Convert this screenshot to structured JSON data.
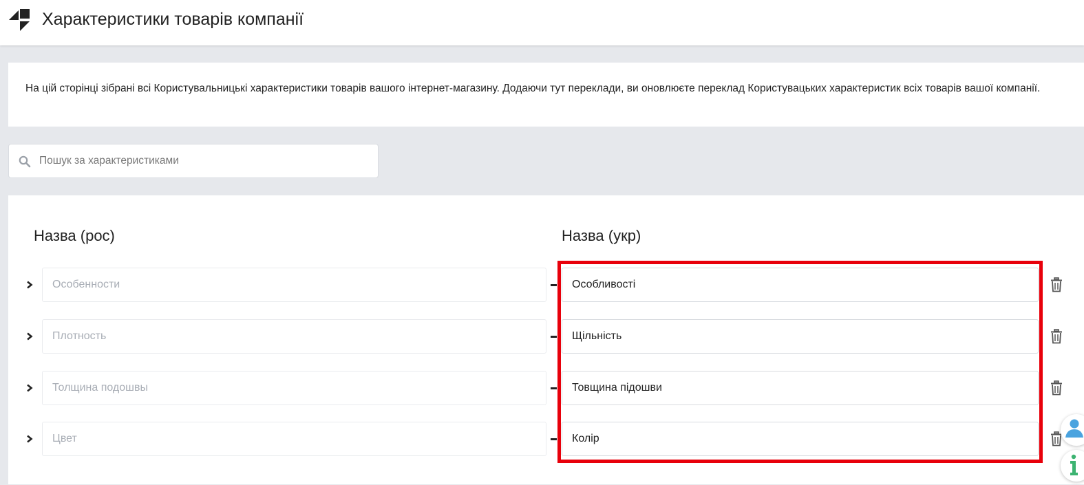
{
  "header": {
    "title": "Характеристики товарів компанії"
  },
  "info": {
    "text": "На цій сторінці зібрані всі Користувальницькі характеристики товарів вашого інтернет-магазину. Додаючи тут переклади, ви оновлюєте переклад Користувацьких характеристик всіх товарів вашої компанії."
  },
  "search": {
    "placeholder": "Пошук за характеристиками",
    "value": ""
  },
  "table": {
    "col_ru": "Назва (рос)",
    "col_uk": "Назва (укр)",
    "rows": [
      {
        "ru": "Особенности",
        "uk": "Особливості"
      },
      {
        "ru": "Плотность",
        "uk": "Щільність"
      },
      {
        "ru": "Толщина подошвы",
        "uk": "Товщина підошви"
      },
      {
        "ru": "Цвет",
        "uk": "Колір"
      }
    ]
  },
  "colors": {
    "highlight": "#e8000b",
    "background": "#e6e8ec",
    "user_icon": "#4aa3df",
    "info_icon": "#3cb371"
  },
  "icons": {
    "logo": "cube-logo-icon",
    "search": "search-icon",
    "expand": "chevron-right-icon",
    "delete": "trash-icon",
    "support": "user-support-icon",
    "info": "info-icon"
  }
}
